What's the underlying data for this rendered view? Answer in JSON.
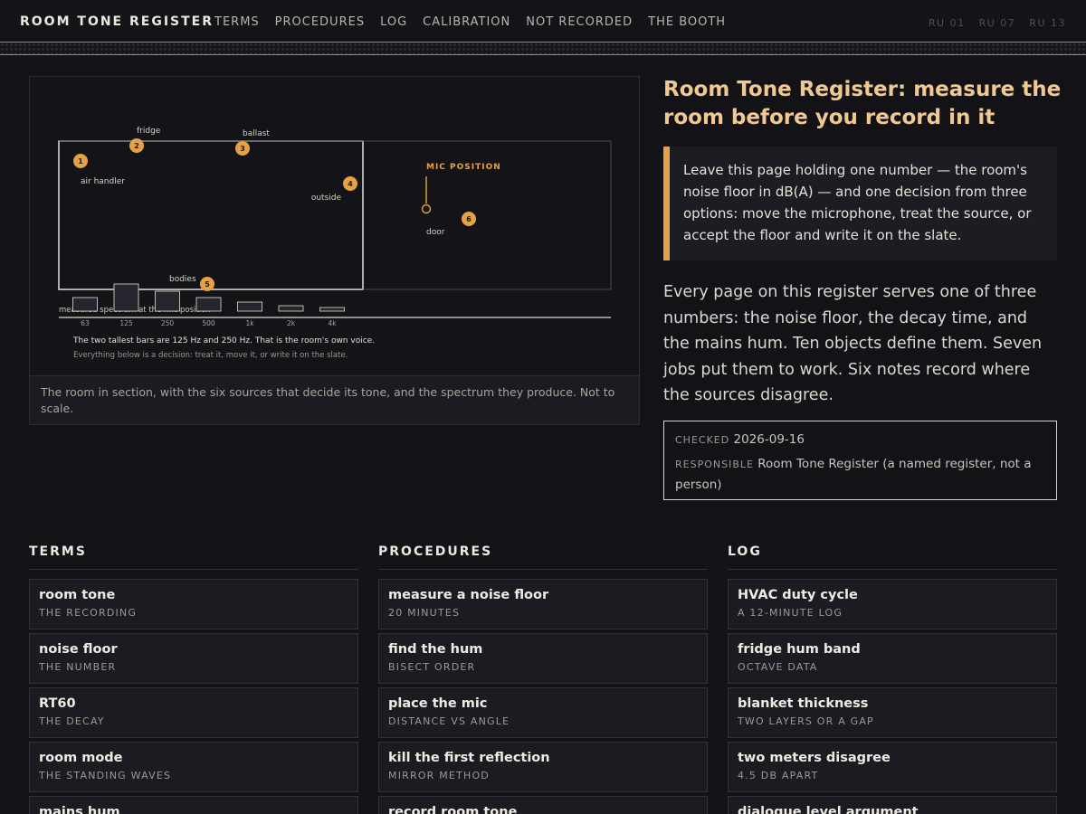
{
  "header": {
    "brand": "ROOM TONE REGISTER",
    "nav": [
      "TERMS",
      "PROCEDURES",
      "LOG",
      "CALIBRATION",
      "NOT RECORDED",
      "THE BOOTH"
    ],
    "codes": [
      "RU 01",
      "RU 07",
      "RU 13"
    ]
  },
  "figure": {
    "sources": [
      {
        "n": "1",
        "label": "air handler"
      },
      {
        "n": "2",
        "label": "fridge"
      },
      {
        "n": "3",
        "label": "ballast"
      },
      {
        "n": "4",
        "label": "outside"
      },
      {
        "n": "5",
        "label": "bodies"
      },
      {
        "n": "6",
        "label": "door"
      }
    ],
    "mic_label": "MIC POSITION",
    "spectrum_label": "measured spectrum at the mic position",
    "note_main": "The two tallest bars are 125 Hz and 250 Hz. That is the room's own voice.",
    "note_sub": "Everything below is a decision: treat it, move it, or write it on the slate.",
    "caption": "The room in section, with the six sources that decide its tone, and the spectrum they produce. Not to scale."
  },
  "chart_data": {
    "type": "bar",
    "categories": [
      "63",
      "125",
      "250",
      "500",
      "1k",
      "2k",
      "4k"
    ],
    "values": [
      15,
      30,
      22,
      15,
      10,
      6,
      4
    ],
    "xlabel": "",
    "ylabel": "",
    "grid": false
  },
  "article": {
    "title": "Room Tone Register: measure the room before you record in it",
    "callout": "Leave this page holding one number — the room's noise floor in dB(A) — and one decision from three options: move the microphone, treat the source, or accept the floor and write it on the slate.",
    "intro": "Every page on this register serves one of three numbers: the noise floor, the decay time, and the mains hum. Ten objects define them. Seven jobs put them to work. Six notes record where the sources disagree.",
    "checked_key": "CHECKED",
    "checked_val": "2026-09-16",
    "responsible_key": "RESPONSIBLE",
    "responsible_val": "Room Tone Register (a named register, not a person)"
  },
  "columns": [
    {
      "heading": "TERMS",
      "items": [
        {
          "title": "room tone",
          "sub": "THE RECORDING"
        },
        {
          "title": "noise floor",
          "sub": "THE NUMBER"
        },
        {
          "title": "RT60",
          "sub": "THE DECAY"
        },
        {
          "title": "room mode",
          "sub": "THE STANDING WAVES"
        },
        {
          "title": "mains hum",
          "sub": ""
        }
      ]
    },
    {
      "heading": "PROCEDURES",
      "items": [
        {
          "title": "measure a noise floor",
          "sub": "20 MINUTES"
        },
        {
          "title": "find the hum",
          "sub": "BISECT ORDER"
        },
        {
          "title": "place the mic",
          "sub": "DISTANCE VS ANGLE"
        },
        {
          "title": "kill the first reflection",
          "sub": "MIRROR METHOD"
        },
        {
          "title": "record room tone",
          "sub": ""
        }
      ]
    },
    {
      "heading": "LOG",
      "items": [
        {
          "title": "HVAC duty cycle",
          "sub": "A 12-MINUTE LOG"
        },
        {
          "title": "fridge hum band",
          "sub": "OCTAVE DATA"
        },
        {
          "title": "blanket thickness",
          "sub": "TWO LAYERS OR A GAP"
        },
        {
          "title": "two meters disagree",
          "sub": "4.5 DB APART"
        },
        {
          "title": "dialogue level argument",
          "sub": ""
        }
      ]
    }
  ],
  "colors": {
    "accent": "#e5a244",
    "title": "#f0c894",
    "bg": "#131317"
  }
}
